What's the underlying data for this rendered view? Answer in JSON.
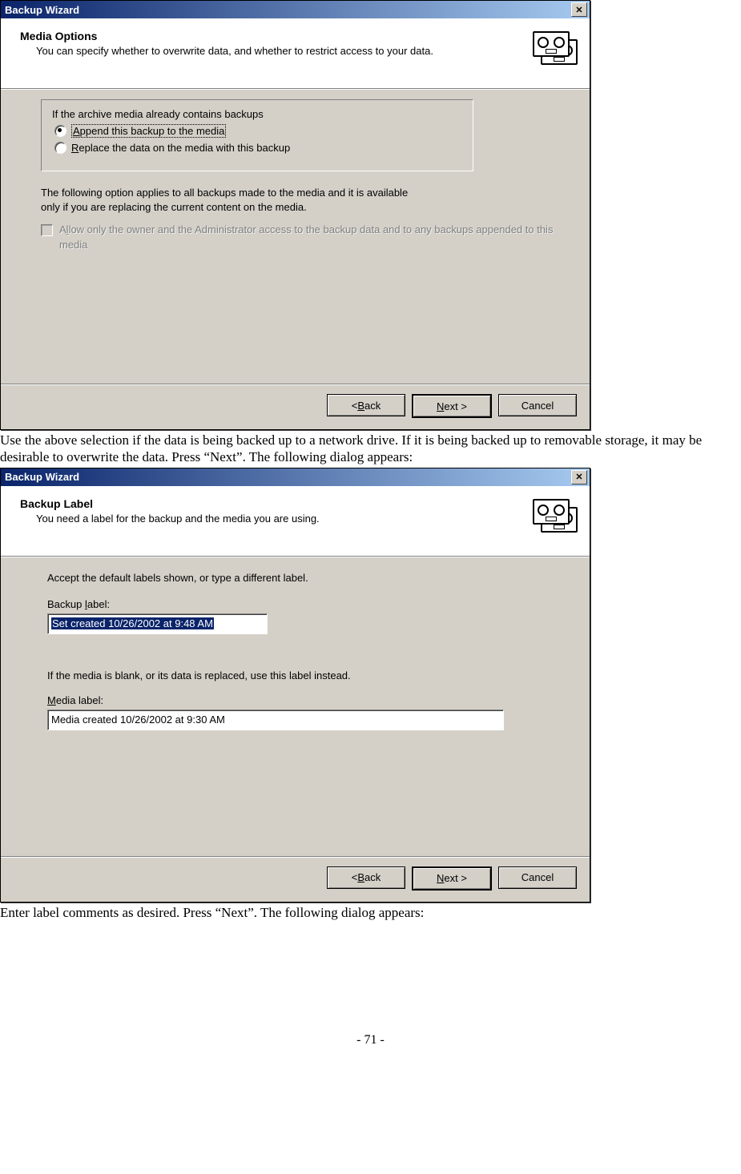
{
  "dialog1": {
    "title": "Backup Wizard",
    "header_title": "Media Options",
    "header_sub": "You can specify whether to overwrite data, and whether to restrict access to your data.",
    "fieldset_legend": "If the archive media already contains backups",
    "radio1_prefix": "A",
    "radio1_rest": "ppend this backup to the media",
    "radio2_prefix": "R",
    "radio2_rest": "eplace the data on the media with this backup",
    "info_para": "The following option applies to all backups made to the media and it is available only if you are replacing the current content on the media.",
    "checkbox_prefix": "A",
    "checkbox_mid": "l",
    "checkbox_rest": "low only the owner and the Administrator access to the backup data and to any backups appended to this media",
    "back_b": "B",
    "back_rest": "ack",
    "next_n": "N",
    "next_rest": "ext >",
    "cancel": "Cancel"
  },
  "para1": "Use the above selection if the data is being backed up to a network drive.  If it is being backed up to removable storage, it may be desirable to overwrite the data.  Press “Next”.  The following dialog appears:",
  "dialog2": {
    "title": "Backup Wizard",
    "header_title": "Backup Label",
    "header_sub": "You need a label for the backup and the media you are using.",
    "instr1": "Accept the default labels shown, or type a different label.",
    "label1_prefix": "Backup ",
    "label1_l": "l",
    "label1_rest": "abel:",
    "input1_value": "Set created 10/26/2002 at 9:48 AM",
    "instr2": "If the media is blank, or its data is replaced, use this label instead.",
    "label2_m": "M",
    "label2_rest": "edia label:",
    "input2_value": "Media created 10/26/2002 at 9:30 AM",
    "back_b": "B",
    "back_rest": "ack",
    "next_n": "N",
    "next_rest": "ext >",
    "cancel": "Cancel"
  },
  "para2": "Enter label comments as desired.  Press “Next”.  The following dialog appears:",
  "page_number": "- 71 -"
}
